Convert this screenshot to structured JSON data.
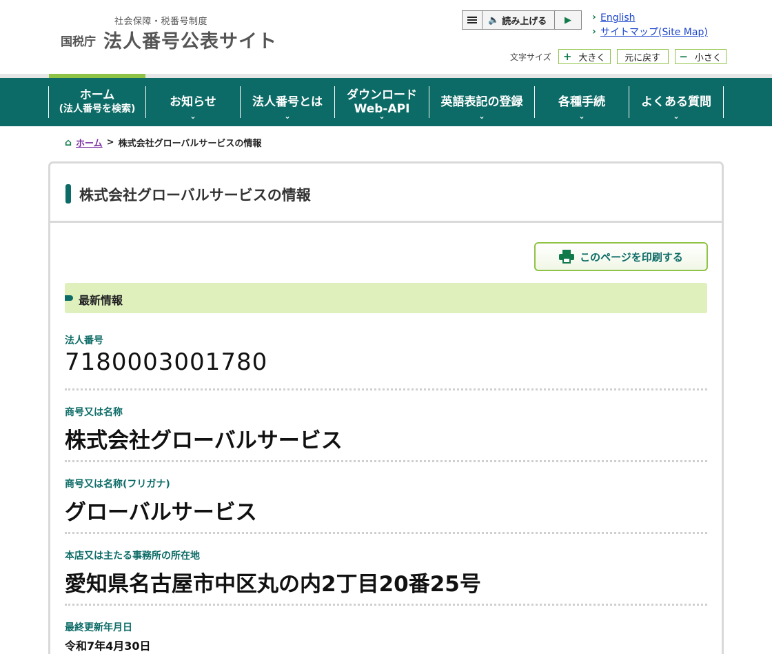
{
  "header": {
    "logo_sub": "社会保障・税番号制度",
    "logo_agency": "国税庁",
    "logo_main": "法人番号公表サイト",
    "read_aloud_label": "読み上げる",
    "links": [
      "English",
      "サイトマップ(Site Map)"
    ],
    "font_size": {
      "label": "文字サイズ",
      "larger": "大きく",
      "reset": "元に戻す",
      "smaller": "小さく"
    }
  },
  "nav": {
    "items": [
      {
        "l1": "ホーム",
        "l2": "(法人番号を検索)"
      },
      {
        "l1": "お知らせ"
      },
      {
        "l1": "法人番号とは"
      },
      {
        "l1": "ダウンロード",
        "l2": "Web-API"
      },
      {
        "l1": "英語表記の登録"
      },
      {
        "l1": "各種手続"
      },
      {
        "l1": "よくある質問"
      }
    ]
  },
  "breadcrumb": {
    "home": "ホーム",
    "separator": ">",
    "current": "株式会社グローバルサービスの情報"
  },
  "panel": {
    "title": "株式会社グローバルサービスの情報",
    "print_label": "このページを印刷する",
    "section_title": "最新情報",
    "fields": [
      {
        "label": "法人番号",
        "value": "7180003001780"
      },
      {
        "label": "商号又は名称",
        "value": "株式会社グローバルサービス"
      },
      {
        "label": "商号又は名称(フリガナ)",
        "value": "グローバルサービス"
      },
      {
        "label": "本店又は主たる事務所の所在地",
        "value": "愛知県名古屋市中区丸の内2丁目20番25号"
      },
      {
        "label": "最終更新年月日",
        "value": "令和7年4月30日"
      }
    ]
  },
  "colors": {
    "primary": "#0c6b66",
    "accent": "#8fc346",
    "section_bg": "#dff0bd",
    "link": "#1a44cc"
  }
}
